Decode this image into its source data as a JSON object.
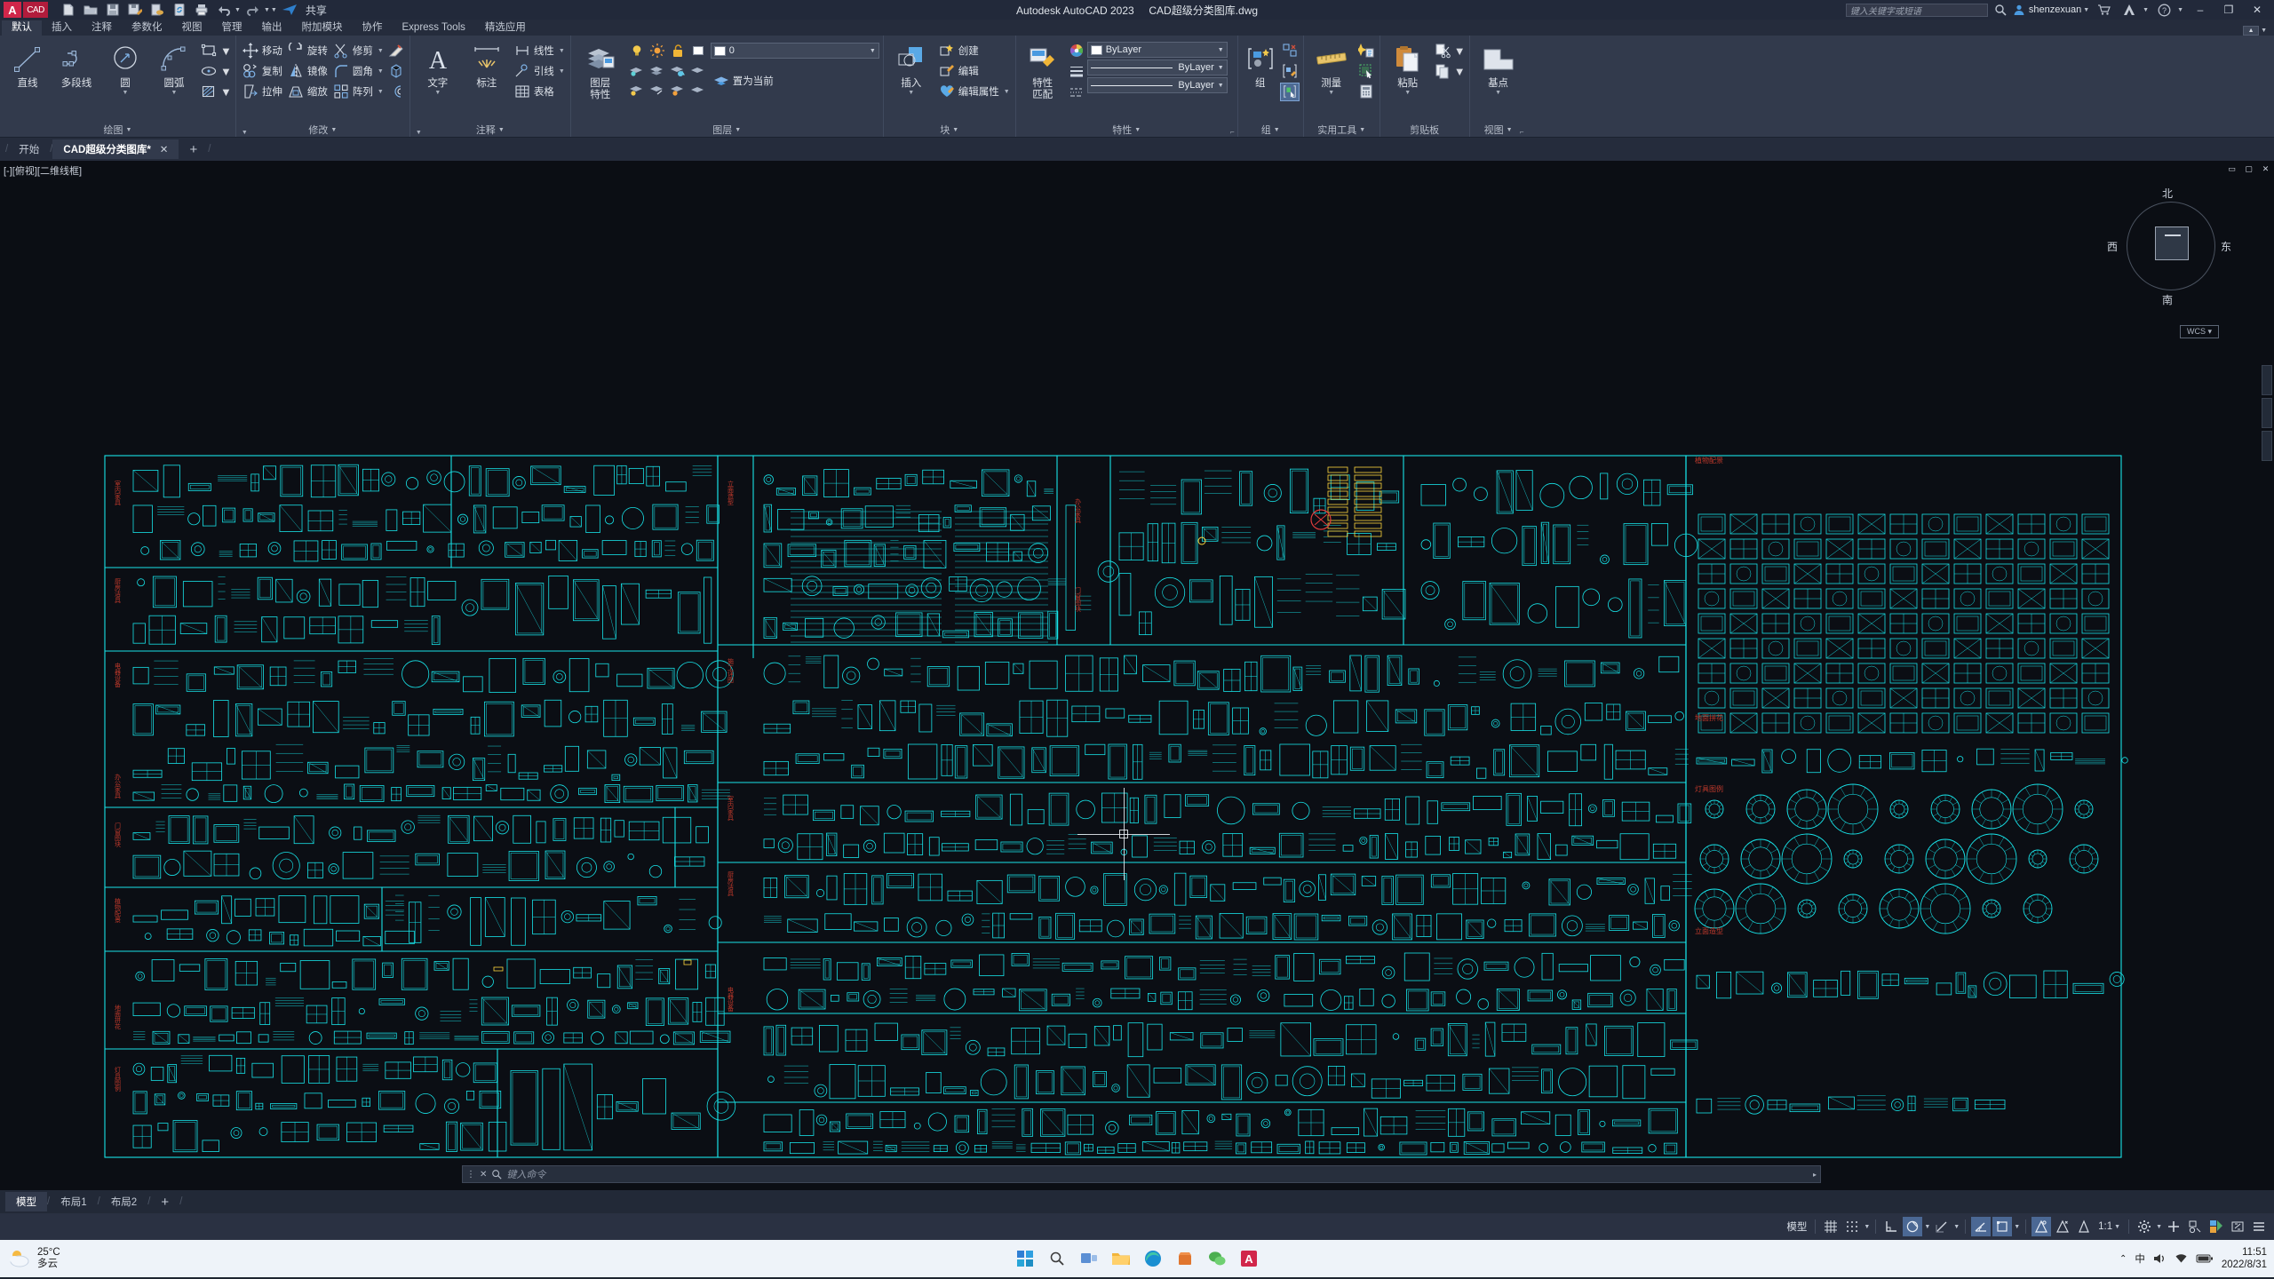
{
  "titlebar": {
    "app_title": "Autodesk AutoCAD 2023",
    "file_title": "CAD超级分类图库.dwg",
    "share_label": "共享",
    "search_placeholder": "键入关键字或短语",
    "user_name": "shenzexuan",
    "quick_access": [
      {
        "name": "new-file-icon",
        "label": "新建"
      },
      {
        "name": "open-file-icon",
        "label": "打开"
      },
      {
        "name": "save-icon",
        "label": "保存"
      },
      {
        "name": "save-as-icon",
        "label": "另存为"
      },
      {
        "name": "cloud-save-icon",
        "label": "保存到云"
      },
      {
        "name": "sync-icon",
        "label": "同步"
      },
      {
        "name": "print-icon",
        "label": "打印"
      },
      {
        "name": "undo-icon",
        "label": "放弃"
      },
      {
        "name": "redo-icon",
        "label": "重做"
      }
    ],
    "window_buttons": {
      "minimize": "–",
      "maximize": "❐",
      "close": "✕"
    }
  },
  "ribbon_tabs": [
    {
      "label": "默认",
      "active": true
    },
    {
      "label": "插入",
      "active": false
    },
    {
      "label": "注释",
      "active": false
    },
    {
      "label": "参数化",
      "active": false
    },
    {
      "label": "视图",
      "active": false
    },
    {
      "label": "管理",
      "active": false
    },
    {
      "label": "输出",
      "active": false
    },
    {
      "label": "附加模块",
      "active": false
    },
    {
      "label": "协作",
      "active": false
    },
    {
      "label": "Express Tools",
      "active": false
    },
    {
      "label": "精选应用",
      "active": false
    }
  ],
  "panels": {
    "draw": {
      "title": "绘图",
      "big": [
        {
          "label": "直线",
          "icon": "line-icon"
        },
        {
          "label": "多段线",
          "icon": "polyline-icon"
        },
        {
          "label": "圆",
          "icon": "circle-icon",
          "dropdown": true
        },
        {
          "label": "圆弧",
          "icon": "arc-icon",
          "dropdown": true
        }
      ],
      "small": [
        {
          "icon": "rectangle-icon",
          "dropdown": true
        },
        {
          "icon": "ellipse-icon",
          "dropdown": true
        },
        {
          "icon": "hatch-icon",
          "dropdown": true
        }
      ],
      "expand": "展开绘图面板"
    },
    "modify": {
      "title": "修改",
      "items": [
        {
          "label": "移动",
          "icon": "move-icon"
        },
        {
          "label": "旋转",
          "icon": "rotate-icon"
        },
        {
          "label": "修剪",
          "icon": "trim-icon",
          "dropdown": true
        },
        {
          "label": "复制",
          "icon": "copy-icon"
        },
        {
          "label": "镜像",
          "icon": "mirror-icon"
        },
        {
          "label": "圆角",
          "icon": "fillet-icon",
          "dropdown": true
        },
        {
          "label": "拉伸",
          "icon": "stretch-icon"
        },
        {
          "label": "缩放",
          "icon": "scale-icon"
        },
        {
          "label": "阵列",
          "icon": "array-icon",
          "dropdown": true
        }
      ],
      "extra_icons": [
        "erase-icon",
        "3d-solid-icon",
        "offset-icon"
      ],
      "expand": "展开修改面板"
    },
    "annotation": {
      "title": "注释",
      "big": [
        {
          "label": "文字",
          "icon": "text-icon",
          "dropdown": true
        },
        {
          "label": "标注",
          "icon": "dimension-icon"
        }
      ],
      "small": [
        {
          "label": "线性",
          "icon": "linear-dim-icon",
          "dropdown": true
        },
        {
          "label": "引线",
          "icon": "leader-icon",
          "dropdown": true
        },
        {
          "label": "表格",
          "icon": "table-icon"
        }
      ]
    },
    "layer": {
      "title": "图层",
      "big": {
        "label1": "图层",
        "label2": "特性",
        "icon": "layer-properties-icon"
      },
      "current_layer": "0",
      "set_current_label": "置为当前",
      "state_icons": [
        "lightbulb-icon",
        "sun-icon",
        "unlock-icon",
        "color-swatch-icon"
      ],
      "grid_icons": [
        "layer-isolate-icon",
        "layer-off-icon",
        "layer-freeze-icon",
        "layer-on-icon",
        "layer-unisolate-icon",
        "layer-thaw-icon",
        "layer-lock-icon"
      ]
    },
    "block": {
      "title": "块",
      "big": {
        "label": "插入",
        "icon": "insert-block-icon",
        "dropdown": true
      },
      "items": [
        {
          "label": "创建",
          "icon": "create-block-icon"
        },
        {
          "label": "编辑",
          "icon": "edit-block-icon"
        },
        {
          "label": "编辑属性",
          "icon": "edit-attributes-icon",
          "dropdown": true
        }
      ]
    },
    "properties": {
      "title": "特性",
      "big": {
        "label1": "特性",
        "label2": "匹配",
        "icon": "match-properties-icon"
      },
      "color": "ByLayer",
      "lineweight": "ByLayer",
      "linetype": "ByLayer",
      "side_icons": [
        "color-wheel-icon",
        "lineweight-icon",
        "linetype-icon"
      ]
    },
    "group": {
      "title": "组",
      "big": {
        "label": "组",
        "icon": "group-icon"
      },
      "items": [
        "ungroup-icon",
        "group-edit-icon",
        "group-selection-icon"
      ]
    },
    "utilities": {
      "title": "实用工具",
      "big": {
        "label": "测量",
        "icon": "measure-icon",
        "dropdown": true
      },
      "items": [
        "quick-select-icon",
        "quick-calc-icon",
        "select-all-icon"
      ]
    },
    "clipboard": {
      "title": "剪贴板",
      "big": {
        "label": "粘贴",
        "icon": "paste-icon",
        "dropdown": true
      },
      "items": [
        {
          "icon": "cut-icon",
          "dropdown": true
        },
        {
          "icon": "copy-clip-icon",
          "dropdown": true
        }
      ]
    },
    "view": {
      "title": "视图",
      "big": {
        "label": "基点",
        "icon": "base-point-icon",
        "dropdown": true
      }
    }
  },
  "file_tabs": [
    {
      "label": "开始",
      "active": false
    },
    {
      "label": "CAD超级分类图库*",
      "active": true,
      "close": "✕"
    }
  ],
  "file_tab_add": "+",
  "canvas": {
    "viewport_label": "[-][俯视][二维线框]",
    "ucs_label": "WCS ▾",
    "compass": {
      "north": "北",
      "south": "南",
      "east": "东",
      "west": "西"
    },
    "viewport_controls": [
      "restore-icon",
      "minimize-icon",
      "close-viewport-icon"
    ],
    "drawing_title": "CAD超级分类图库",
    "background": "#0b0e14",
    "entity_color": "#18e3e8",
    "label_color": "#c0392b",
    "block_labels": [
      "室内家具",
      "厨房洁具",
      "电器设备",
      "办公家具",
      "门窗图块",
      "植物配景",
      "地面拼花",
      "灯具图例",
      "立面造型",
      "施工详图"
    ]
  },
  "command_line": {
    "placeholder": "键入命令",
    "icons": [
      "cmd-options-icon",
      "cmd-close-icon",
      "cmd-search-icon"
    ],
    "caret": "▸"
  },
  "layout_tabs": [
    {
      "label": "模型",
      "active": true
    },
    {
      "label": "布局1",
      "active": false
    },
    {
      "label": "布局2",
      "active": false
    }
  ],
  "layout_add": "+",
  "status_bar": {
    "model_label": "模型",
    "scale": "1:1",
    "items": [
      {
        "name": "grid-display-toggle",
        "label": "栅格",
        "on": false
      },
      {
        "name": "snap-mode-toggle",
        "label": "捕捉",
        "on": false
      },
      {
        "name": "infer-constraints-toggle",
        "label": "推断约束",
        "on": false
      },
      {
        "name": "dynamic-ucs-toggle",
        "label": "动态UCS",
        "on": true
      },
      {
        "name": "ortho-mode-toggle",
        "label": "正交",
        "on": false
      },
      {
        "name": "polar-tracking-toggle",
        "label": "极轴追踪",
        "on": true
      },
      {
        "name": "isometric-draft-toggle",
        "label": "等轴测草图",
        "on": true
      },
      {
        "name": "object-snap-toggle",
        "label": "对象捕捉",
        "on": true
      },
      {
        "name": "osnap-tracking-toggle",
        "label": "对象捕捉追踪",
        "on": false
      },
      {
        "name": "annotation-visibility-toggle",
        "label": "注释可见性",
        "on": false
      }
    ],
    "right_icons": [
      "workspace-gear-icon",
      "customization-icon",
      "hardware-accel-icon",
      "isolate-objects-icon",
      "clean-screen-icon",
      "menu-icon"
    ]
  },
  "taskbar": {
    "weather_temp": "25°C",
    "weather_desc": "多云",
    "apps": [
      {
        "name": "start-button",
        "label": "开始"
      },
      {
        "name": "search-taskbar-icon",
        "label": "搜索"
      },
      {
        "name": "task-view-icon",
        "label": "任务视图"
      },
      {
        "name": "file-explorer-icon",
        "label": "文件资源管理器"
      },
      {
        "name": "edge-browser-icon",
        "label": "Microsoft Edge"
      },
      {
        "name": "store-icon",
        "label": "应用商店"
      },
      {
        "name": "wechat-icon",
        "label": "微信"
      },
      {
        "name": "autocad-taskbar-icon",
        "label": "AutoCAD 2023"
      }
    ],
    "tray": [
      "chevron-up-icon",
      "ime-icon",
      "volume-icon",
      "network-icon",
      "battery-icon"
    ],
    "ime_label": "中",
    "time": "11:51",
    "date": "2022/8/31"
  }
}
